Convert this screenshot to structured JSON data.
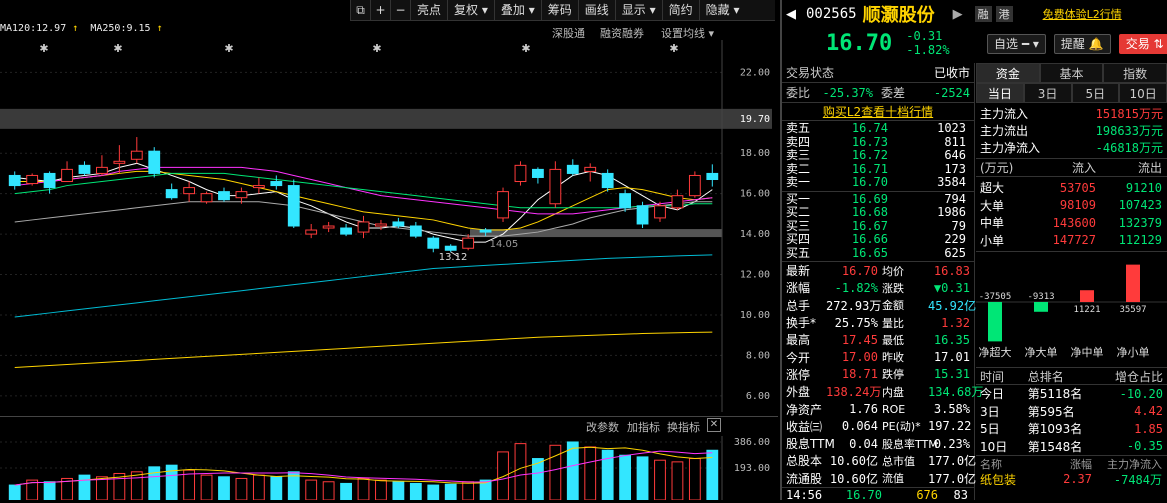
{
  "toolbar": {
    "items": [
      "亮点",
      "复权",
      "叠加",
      "筹码",
      "画线",
      "显示",
      "简约",
      "隐藏"
    ],
    "icons": [
      "frame-icon",
      "plus-icon",
      "minus-icon"
    ]
  },
  "ma": {
    "ma120": "MA120:12.97",
    "ma250": "MA250:9.15",
    "arrow": "↑"
  },
  "chart_links": [
    "深股通",
    "融资融券",
    "设置均线"
  ],
  "indicator_links": [
    "改参数",
    "加指标",
    "换指标"
  ],
  "yaxis": [
    "22.00",
    "19.70",
    "18.00",
    "16.00",
    "14.00",
    "12.00",
    "10.00",
    "8.00",
    "6.00"
  ],
  "vol_yaxis": [
    "386.00",
    "193.00"
  ],
  "annotations": {
    "low": "13.12",
    "low2": "14.05"
  },
  "chart_data": {
    "type": "candlestick",
    "ylim": [
      5.2,
      23.6
    ],
    "candles": [
      {
        "o": 16.9,
        "c": 16.4,
        "h": 17.1,
        "l": 16.2
      },
      {
        "o": 16.5,
        "c": 16.9,
        "h": 17.0,
        "l": 16.4
      },
      {
        "o": 17.0,
        "c": 16.3,
        "h": 17.1,
        "l": 16.0
      },
      {
        "o": 16.6,
        "c": 17.2,
        "h": 17.6,
        "l": 16.6
      },
      {
        "o": 17.4,
        "c": 17.0,
        "h": 17.6,
        "l": 16.9
      },
      {
        "o": 17.0,
        "c": 17.3,
        "h": 17.9,
        "l": 16.9
      },
      {
        "o": 17.5,
        "c": 17.6,
        "h": 18.4,
        "l": 17.0
      },
      {
        "o": 17.7,
        "c": 18.1,
        "h": 18.8,
        "l": 17.5
      },
      {
        "o": 18.1,
        "c": 17.0,
        "h": 18.3,
        "l": 16.8
      },
      {
        "o": 16.2,
        "c": 15.8,
        "h": 16.5,
        "l": 15.7
      },
      {
        "o": 16.0,
        "c": 16.3,
        "h": 16.6,
        "l": 15.6
      },
      {
        "o": 15.6,
        "c": 16.0,
        "h": 16.1,
        "l": 15.5
      },
      {
        "o": 16.1,
        "c": 15.7,
        "h": 16.3,
        "l": 15.6
      },
      {
        "o": 15.8,
        "c": 16.1,
        "h": 16.3,
        "l": 15.5
      },
      {
        "o": 16.3,
        "c": 16.4,
        "h": 16.8,
        "l": 16.0
      },
      {
        "o": 16.6,
        "c": 16.4,
        "h": 16.9,
        "l": 16.2
      },
      {
        "o": 16.4,
        "c": 14.4,
        "h": 16.7,
        "l": 14.3
      },
      {
        "o": 14.0,
        "c": 14.2,
        "h": 14.5,
        "l": 13.8
      },
      {
        "o": 14.3,
        "c": 14.4,
        "h": 14.6,
        "l": 14.1
      },
      {
        "o": 14.3,
        "c": 14.0,
        "h": 14.5,
        "l": 13.9
      },
      {
        "o": 14.1,
        "c": 14.6,
        "h": 14.9,
        "l": 13.8
      },
      {
        "o": 14.4,
        "c": 14.5,
        "h": 14.7,
        "l": 14.2
      },
      {
        "o": 14.6,
        "c": 14.4,
        "h": 14.8,
        "l": 14.3
      },
      {
        "o": 14.4,
        "c": 13.9,
        "h": 14.6,
        "l": 13.8
      },
      {
        "o": 13.8,
        "c": 13.3,
        "h": 13.9,
        "l": 13.1
      },
      {
        "o": 13.4,
        "c": 13.2,
        "h": 13.5,
        "l": 13.1
      },
      {
        "o": 13.3,
        "c": 13.8,
        "h": 14.0,
        "l": 13.2
      },
      {
        "o": 14.2,
        "c": 14.1,
        "h": 14.3,
        "l": 13.9
      },
      {
        "o": 14.8,
        "c": 16.1,
        "h": 16.3,
        "l": 14.6
      },
      {
        "o": 16.6,
        "c": 17.4,
        "h": 17.6,
        "l": 16.4
      },
      {
        "o": 17.2,
        "c": 16.8,
        "h": 17.3,
        "l": 16.5
      },
      {
        "o": 15.5,
        "c": 17.2,
        "h": 17.6,
        "l": 15.3
      },
      {
        "o": 17.4,
        "c": 17.0,
        "h": 17.7,
        "l": 16.9
      },
      {
        "o": 17.1,
        "c": 17.3,
        "h": 17.5,
        "l": 16.6
      },
      {
        "o": 17.0,
        "c": 16.3,
        "h": 17.2,
        "l": 16.1
      },
      {
        "o": 16.0,
        "c": 15.3,
        "h": 16.2,
        "l": 15.1
      },
      {
        "o": 15.4,
        "c": 14.5,
        "h": 15.6,
        "l": 14.3
      },
      {
        "o": 14.8,
        "c": 15.4,
        "h": 15.6,
        "l": 14.6
      },
      {
        "o": 15.3,
        "c": 15.9,
        "h": 16.2,
        "l": 15.2
      },
      {
        "o": 15.9,
        "c": 16.9,
        "h": 17.1,
        "l": 15.8
      },
      {
        "o": 17.0,
        "c": 16.7,
        "h": 17.45,
        "l": 16.35
      }
    ],
    "volume": [
      90,
      120,
      110,
      130,
      150,
      140,
      160,
      170,
      200,
      210,
      180,
      150,
      140,
      130,
      150,
      140,
      170,
      120,
      110,
      100,
      130,
      120,
      110,
      100,
      90,
      95,
      110,
      120,
      290,
      340,
      250,
      330,
      350,
      320,
      300,
      270,
      260,
      240,
      230,
      250,
      300
    ],
    "vol_ylim": [
      0,
      386
    ],
    "lines": {
      "ma5": [
        16.8,
        16.7,
        16.6,
        16.8,
        16.9,
        17.0,
        17.3,
        17.5,
        17.2,
        16.9,
        16.6,
        16.2,
        15.9,
        15.9,
        16.0,
        16.1,
        15.7,
        15.4,
        15.0,
        14.6,
        14.3,
        14.3,
        14.4,
        14.3,
        14.0,
        13.8,
        13.6,
        13.6,
        14.0,
        14.8,
        15.7,
        16.3,
        16.9,
        17.1,
        16.9,
        16.4,
        15.9,
        15.4,
        15.2,
        15.6,
        16.2
      ],
      "ma10": [
        16.6,
        16.6,
        16.6,
        16.7,
        16.8,
        16.9,
        17.0,
        17.1,
        17.1,
        17.0,
        16.9,
        16.8,
        16.7,
        16.5,
        16.3,
        16.1,
        15.9,
        15.7,
        15.5,
        15.3,
        15.1,
        15.0,
        14.9,
        14.8,
        14.7,
        14.5,
        14.3,
        14.2,
        14.2,
        14.3,
        14.6,
        15.0,
        15.4,
        15.8,
        16.2,
        16.3,
        16.2,
        16.0,
        15.8,
        15.7,
        15.8
      ],
      "ma20": [
        16.4,
        16.5,
        16.6,
        16.7,
        16.8,
        16.9,
        17.1,
        17.2,
        17.3,
        17.3,
        17.3,
        17.3,
        17.3,
        17.3,
        17.2,
        17.1,
        16.9,
        16.7,
        16.5,
        16.3,
        16.1,
        15.9,
        15.8,
        15.7,
        15.6,
        15.5,
        15.4,
        15.3,
        15.2,
        15.1,
        15.0,
        15.0,
        15.0,
        15.1,
        15.2,
        15.3,
        15.4,
        15.5,
        15.6,
        15.7,
        15.8
      ],
      "ma30": [
        16.0,
        16.1,
        16.2,
        16.4,
        16.5,
        16.6,
        16.7,
        16.8,
        16.9,
        17.0,
        17.0,
        17.0,
        17.0,
        16.9,
        16.8,
        16.7,
        16.6,
        16.5,
        16.4,
        16.3,
        16.2,
        16.1,
        16.0,
        15.9,
        15.8,
        15.7,
        15.6,
        15.5,
        15.4,
        15.3,
        15.3,
        15.3,
        15.3,
        15.3,
        15.3,
        15.3,
        15.4,
        15.4,
        15.4,
        15.5,
        15.5
      ],
      "ma60": [
        14.6,
        14.7,
        14.8,
        14.9,
        15.0,
        15.1,
        15.2,
        15.3,
        15.4,
        15.5,
        15.6,
        15.6,
        15.6,
        15.6,
        15.6,
        15.5,
        15.4,
        15.2,
        15.0,
        14.8,
        14.6,
        14.4,
        14.3,
        14.2,
        14.1,
        14.0,
        13.9,
        13.9,
        13.9,
        14.0,
        14.1,
        14.3,
        14.5,
        14.8,
        15.0,
        15.2,
        15.3,
        15.4,
        15.5,
        15.6,
        15.6
      ],
      "ma120": [
        9.9,
        10.0,
        10.1,
        10.2,
        10.3,
        10.4,
        10.5,
        10.6,
        10.7,
        10.8,
        10.9,
        11.0,
        11.1,
        11.2,
        11.3,
        11.4,
        11.5,
        11.6,
        11.7,
        11.8,
        11.9,
        12.0,
        12.1,
        12.2,
        12.3,
        12.35,
        12.4,
        12.45,
        12.5,
        12.55,
        12.6,
        12.65,
        12.7,
        12.75,
        12.8,
        12.83,
        12.86,
        12.89,
        12.92,
        12.95,
        12.97
      ],
      "ma250": [
        7.4,
        7.45,
        7.5,
        7.55,
        7.6,
        7.65,
        7.7,
        7.75,
        7.8,
        7.85,
        7.9,
        7.95,
        8.0,
        8.05,
        8.1,
        8.15,
        8.2,
        8.25,
        8.3,
        8.35,
        8.4,
        8.45,
        8.5,
        8.55,
        8.6,
        8.65,
        8.7,
        8.75,
        8.8,
        8.85,
        8.9,
        8.93,
        8.96,
        8.99,
        9.02,
        9.05,
        9.08,
        9.1,
        9.12,
        9.14,
        9.15
      ]
    },
    "colors": {
      "up": "#ff3b3b",
      "down": "#33e6ff",
      "ma5": "#ffffff",
      "ma10": "#ffd400",
      "ma20": "#ff33ff",
      "ma30": "#00e676",
      "ma60": "#aaaaaa",
      "ma120": "#00bcd4",
      "ma250": "#ffd400"
    }
  },
  "stock": {
    "code": "002565",
    "name": "顺灏股份",
    "tags": [
      "融",
      "港"
    ],
    "l2": "免费体验L2行情",
    "price": "16.70",
    "chg": "-0.31",
    "pct": "-1.82%",
    "btn_watch": "自选",
    "btn_alert": "提醒",
    "btn_trade": "交易"
  },
  "status": {
    "label": "交易状态",
    "value": "已收市"
  },
  "ratio": {
    "wb_label": "委比",
    "wb": "-25.37%",
    "wc_label": "委差",
    "wc": "-2524"
  },
  "l2link": "购买L2查看十档行情",
  "asks": [
    [
      "卖五",
      "16.74",
      "1023"
    ],
    [
      "卖四",
      "16.73",
      "811"
    ],
    [
      "卖三",
      "16.72",
      "646"
    ],
    [
      "卖二",
      "16.71",
      "173"
    ],
    [
      "卖一",
      "16.70",
      "3584"
    ]
  ],
  "bids": [
    [
      "买一",
      "16.69",
      "794"
    ],
    [
      "买二",
      "16.68",
      "1986"
    ],
    [
      "买三",
      "16.67",
      "79"
    ],
    [
      "买四",
      "16.66",
      "229"
    ],
    [
      "买五",
      "16.65",
      "625"
    ]
  ],
  "stats": [
    [
      "最新",
      "16.70",
      "red",
      "均价",
      "16.83",
      "red"
    ],
    [
      "涨幅",
      "-1.82%",
      "grn",
      "涨跌",
      "▼0.31",
      "grn"
    ],
    [
      "总手",
      "272.93万",
      "wht",
      "金额",
      "45.92亿",
      "cyn"
    ],
    [
      "换手*",
      "25.75%",
      "wht",
      "量比",
      "1.32",
      "red"
    ],
    [
      "最高",
      "17.45",
      "red",
      "最低",
      "16.35",
      "grn"
    ],
    [
      "今开",
      "17.00",
      "red",
      "昨收",
      "17.01",
      "wht"
    ],
    [
      "涨停",
      "18.71",
      "red",
      "跌停",
      "15.31",
      "grn"
    ],
    [
      "外盘",
      "138.24万",
      "red",
      "内盘",
      "134.68万",
      "grn"
    ],
    [
      "净资产",
      "1.76",
      "wht",
      "ROE",
      "3.58%",
      "wht"
    ],
    [
      "收益㈢",
      "0.064",
      "wht",
      "PE(动)*",
      "197.22",
      "wht"
    ],
    [
      "股息TTM",
      "0.04",
      "wht",
      "股息率TTM",
      "0.23%",
      "wht"
    ],
    [
      "总股本",
      "10.60亿",
      "wht",
      "总市值",
      "177.0亿",
      "wht"
    ],
    [
      "流通股",
      "10.60亿",
      "wht",
      "流值",
      "177.0亿",
      "wht"
    ]
  ],
  "last_tick": {
    "time": "14:56",
    "price": "16.70",
    "vol": "676",
    "n": "83"
  },
  "fund": {
    "tabs": [
      "资金",
      "基本",
      "指数"
    ],
    "periods": [
      "当日",
      "3日",
      "5日",
      "10日"
    ],
    "flows": [
      [
        "主力流入",
        "151815万元"
      ],
      [
        "主力流出",
        "198633万元"
      ],
      [
        "主力净流入",
        "-46818万元"
      ]
    ],
    "unit": "(万元)",
    "in": "流入",
    "out": "流出",
    "table": [
      [
        "超大",
        "53705",
        "91210"
      ],
      [
        "大单",
        "98109",
        "107423"
      ],
      [
        "中单",
        "143600",
        "132379"
      ],
      [
        "小单",
        "147727",
        "112129"
      ]
    ],
    "bars": [
      {
        "label": "净超大",
        "value": -37505
      },
      {
        "label": "净大单",
        "value": -9313
      },
      {
        "label": "净中单",
        "value": 11221
      },
      {
        "label": "净小单",
        "value": 35597
      }
    ],
    "bar_texts": [
      "-37505",
      "-9313",
      "11221",
      "35597"
    ],
    "rank_head": [
      "时间",
      "总排名",
      "增仓占比"
    ],
    "ranks": [
      [
        "今日",
        "第5118名",
        "-10.20",
        "grn"
      ],
      [
        "3日",
        "第595名",
        "4.42",
        "red"
      ],
      [
        "5日",
        "第1093名",
        "1.85",
        "red"
      ],
      [
        "10日",
        "第1548名",
        "-0.35",
        "grn"
      ]
    ],
    "bottom_head": [
      "名称",
      "涨幅",
      "主力净流入"
    ],
    "bottom_row": [
      "纸包装",
      "2.37",
      "-7484万"
    ]
  }
}
